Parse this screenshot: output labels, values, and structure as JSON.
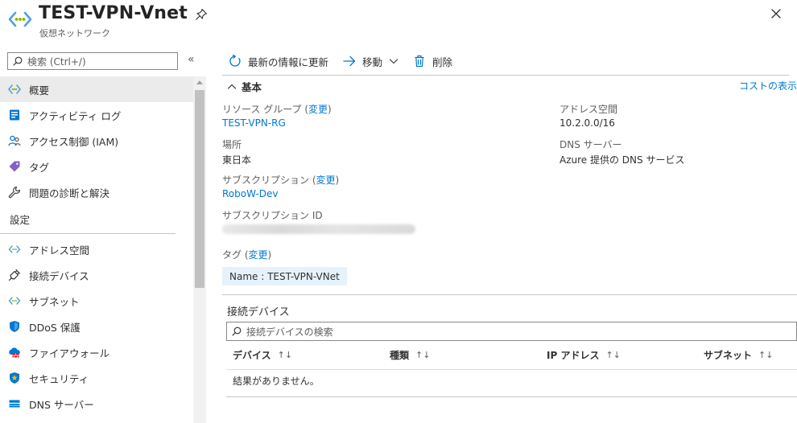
{
  "header": {
    "title": "TEST-VPN-Vnet",
    "subtitle": "仮想ネットワーク"
  },
  "sidebar": {
    "search_placeholder": "検索 (Ctrl+/)",
    "collapse_label": "«",
    "items_top": [
      {
        "label": "概要",
        "icon": "vnet-icon",
        "active": true
      },
      {
        "label": "アクティビティ ログ",
        "icon": "activity-log-icon"
      },
      {
        "label": "アクセス制御 (IAM)",
        "icon": "iam-icon"
      },
      {
        "label": "タグ",
        "icon": "tag-icon"
      },
      {
        "label": "問題の診断と解決",
        "icon": "wrench-icon"
      }
    ],
    "section_settings": "設定",
    "items_settings": [
      {
        "label": "アドレス空間",
        "icon": "address-space-icon"
      },
      {
        "label": "接続デバイス",
        "icon": "plug-icon"
      },
      {
        "label": "サブネット",
        "icon": "subnet-icon"
      },
      {
        "label": "DDoS 保護",
        "icon": "shield-icon"
      },
      {
        "label": "ファイアウォール",
        "icon": "firewall-icon"
      },
      {
        "label": "セキュリティ",
        "icon": "security-icon"
      },
      {
        "label": "DNS サーバー",
        "icon": "dns-icon"
      }
    ]
  },
  "toolbar": {
    "refresh_label": "最新の情報に更新",
    "move_label": "移動",
    "delete_label": "削除"
  },
  "essentials": {
    "heading": "基本",
    "cost_link": "コストの表示",
    "resource_group_label": "リソース グループ",
    "change_label": "変更",
    "resource_group_value": "TEST-VPN-RG",
    "location_label": "場所",
    "location_value": "東日本",
    "subscription_label": "サブスクリプション",
    "subscription_value": "RoboW-Dev",
    "subscription_id_label": "サブスクリプション ID",
    "address_space_label": "アドレス空間",
    "address_space_value": "10.2.0.0/16",
    "dns_label": "DNS サーバー",
    "dns_value": "Azure 提供の DNS サービス",
    "tags_label": "タグ",
    "tag_chip": "Name : TEST-VPN-VNet"
  },
  "connected_devices": {
    "title": "接続デバイス",
    "search_placeholder": "接続デバイスの検索",
    "columns": [
      "デバイス",
      "種類",
      "IP アドレス",
      "サブネット"
    ],
    "sort_glyph": "↑↓",
    "empty_message": "結果がありません。"
  },
  "colors": {
    "accent": "#0078d4",
    "active_bg": "#ebebeb",
    "tag_bg": "#e6f2fb"
  }
}
